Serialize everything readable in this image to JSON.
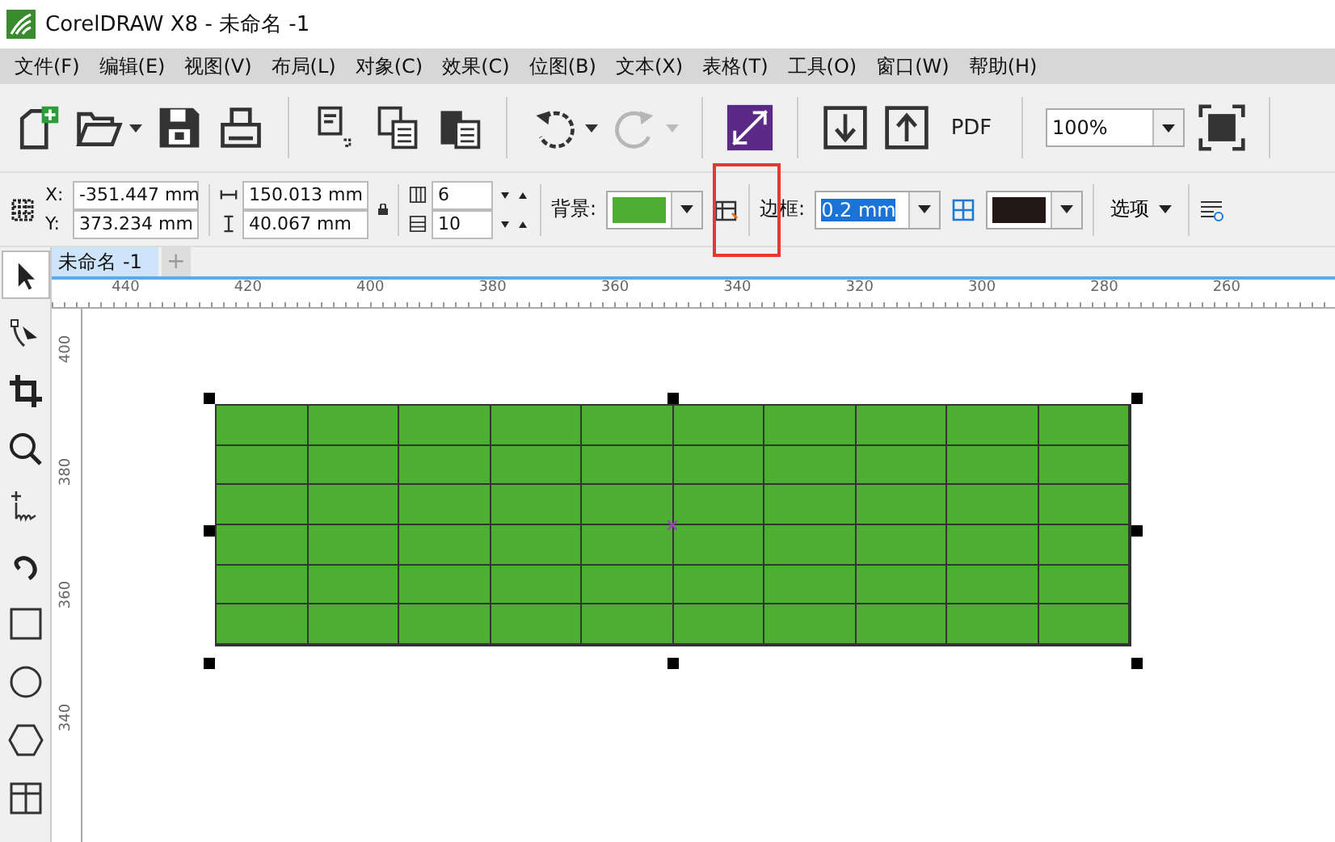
{
  "window": {
    "title": "CorelDRAW X8 - 未命名 -1"
  },
  "menu": [
    "文件(F)",
    "编辑(E)",
    "视图(V)",
    "布局(L)",
    "对象(C)",
    "效果(C)",
    "位图(B)",
    "文本(X)",
    "表格(T)",
    "工具(O)",
    "窗口(W)",
    "帮助(H)"
  ],
  "toolbar": [
    {
      "kind": "new",
      "disabled": false
    },
    {
      "kind": "open",
      "disabled": false
    },
    {
      "kind": "caret",
      "disabled": false
    },
    {
      "kind": "save",
      "disabled": false
    },
    {
      "kind": "print",
      "disabled": false
    },
    {
      "kind": "sep"
    },
    {
      "kind": "cut",
      "disabled": false
    },
    {
      "kind": "copy",
      "disabled": false
    },
    {
      "kind": "paste",
      "disabled": false
    },
    {
      "kind": "sep"
    },
    {
      "kind": "undo",
      "disabled": false
    },
    {
      "kind": "caret",
      "disabled": false
    },
    {
      "kind": "redo",
      "disabled": true
    },
    {
      "kind": "caret",
      "disabled": true
    },
    {
      "kind": "sep"
    },
    {
      "kind": "launcher",
      "disabled": false
    },
    {
      "kind": "sep"
    },
    {
      "kind": "import",
      "disabled": false
    },
    {
      "kind": "export",
      "disabled": false
    },
    {
      "kind": "pdf",
      "label": "PDF",
      "disabled": false
    }
  ],
  "zoom": {
    "value": "100%"
  },
  "property_bar": {
    "x_label": "X:",
    "x": "-351.447 mm",
    "y_label": "Y:",
    "y": "373.234 mm",
    "width": "150.013 mm",
    "height": "40.067 mm",
    "rows": "6",
    "columns": "10",
    "background_label": "背景:",
    "border_label": "边框:",
    "border_width": {
      "value": "0.2 mm",
      "selected": true
    },
    "options": "选项"
  },
  "document_tab": {
    "title": "未命名 -1",
    "add": "+"
  },
  "ruler": {
    "horizontal": [
      "440",
      "420",
      "400",
      "380",
      "360",
      "340",
      "320",
      "300",
      "280",
      "260"
    ],
    "vertical": [
      "400",
      "380",
      "360",
      "340"
    ]
  },
  "tools": [
    {
      "kind": "pointer",
      "selected": true
    },
    {
      "kind": "shape",
      "selected": false
    },
    {
      "kind": "crop",
      "selected": false
    },
    {
      "kind": "zoom",
      "selected": false
    },
    {
      "kind": "freehand",
      "selected": false
    },
    {
      "kind": "artistic",
      "selected": false
    },
    {
      "kind": "rectangle",
      "selected": false
    },
    {
      "kind": "ellipse",
      "selected": false
    },
    {
      "kind": "polygon",
      "selected": false
    },
    {
      "kind": "table",
      "selected": false
    }
  ]
}
